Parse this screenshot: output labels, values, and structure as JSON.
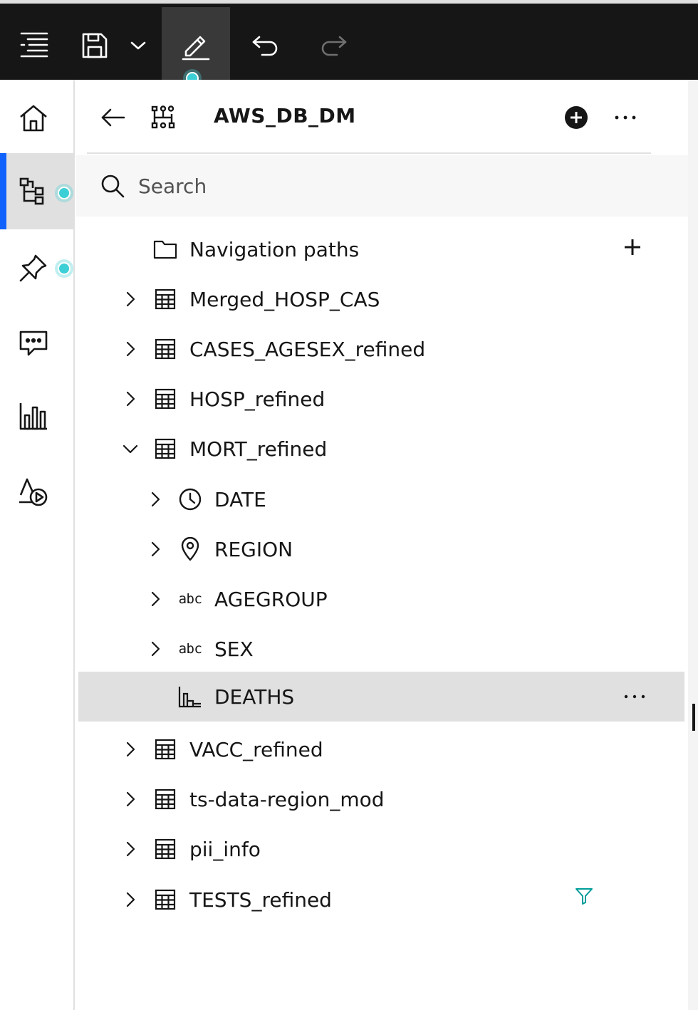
{
  "toolbar": {
    "items": [
      {
        "icon": "toc-menu-icon",
        "active": false,
        "enabled": true
      },
      {
        "icon": "save-icon",
        "active": false,
        "enabled": true
      },
      {
        "icon": "chevron-down-icon",
        "active": false,
        "enabled": true
      },
      {
        "icon": "edit-pencil-icon",
        "active": true,
        "enabled": true
      },
      {
        "icon": "undo-icon",
        "active": false,
        "enabled": true
      },
      {
        "icon": "redo-icon",
        "active": false,
        "enabled": false
      }
    ]
  },
  "rail": {
    "items": [
      {
        "icon": "home-icon",
        "active": false
      },
      {
        "icon": "data-tree-icon",
        "active": true
      },
      {
        "icon": "pin-icon",
        "active": false
      },
      {
        "icon": "chat-icon",
        "active": false
      },
      {
        "icon": "bar-chart-icon",
        "active": false
      },
      {
        "icon": "shapes-play-icon",
        "active": false
      }
    ]
  },
  "panel": {
    "title": "AWS_DB_DM",
    "search_placeholder": "Search"
  },
  "tree": {
    "items": [
      {
        "label": "Navigation paths",
        "type": "folder",
        "level": 0,
        "expandable": false
      },
      {
        "label": "Merged_HOSP_CAS",
        "type": "table",
        "level": 0,
        "expandable": true,
        "expanded": false
      },
      {
        "label": "CASES_AGESEX_refined",
        "type": "table",
        "level": 0,
        "expandable": true,
        "expanded": false
      },
      {
        "label": "HOSP_refined",
        "type": "table",
        "level": 0,
        "expandable": true,
        "expanded": false
      },
      {
        "label": "MORT_refined",
        "type": "table",
        "level": 0,
        "expandable": true,
        "expanded": true
      },
      {
        "label": "DATE",
        "type": "time",
        "level": 1,
        "expandable": true,
        "expanded": false
      },
      {
        "label": "REGION",
        "type": "location",
        "level": 1,
        "expandable": true,
        "expanded": false
      },
      {
        "label": "AGEGROUP",
        "type": "text",
        "level": 1,
        "expandable": true,
        "expanded": false
      },
      {
        "label": "SEX",
        "type": "text",
        "level": 1,
        "expandable": true,
        "expanded": false
      },
      {
        "label": "DEATHS",
        "type": "measure",
        "level": 1,
        "expandable": false,
        "selected": true
      },
      {
        "label": "VACC_refined",
        "type": "table",
        "level": 0,
        "expandable": true,
        "expanded": false
      },
      {
        "label": "ts-data-region_mod",
        "type": "table",
        "level": 0,
        "expandable": true,
        "expanded": false
      },
      {
        "label": "pii_info",
        "type": "table",
        "level": 0,
        "expandable": true,
        "expanded": false
      },
      {
        "label": "TESTS_refined",
        "type": "table",
        "level": 0,
        "expandable": true,
        "expanded": false,
        "filtered": true
      }
    ],
    "text_type_glyph": "abc"
  },
  "colors": {
    "toolbar_bg": "#161616",
    "accent_blue": "#0f62fe",
    "pulse_teal": "#3ccfd6",
    "filter_teal": "#009d9a",
    "selected_row": "#e0e0e0"
  }
}
